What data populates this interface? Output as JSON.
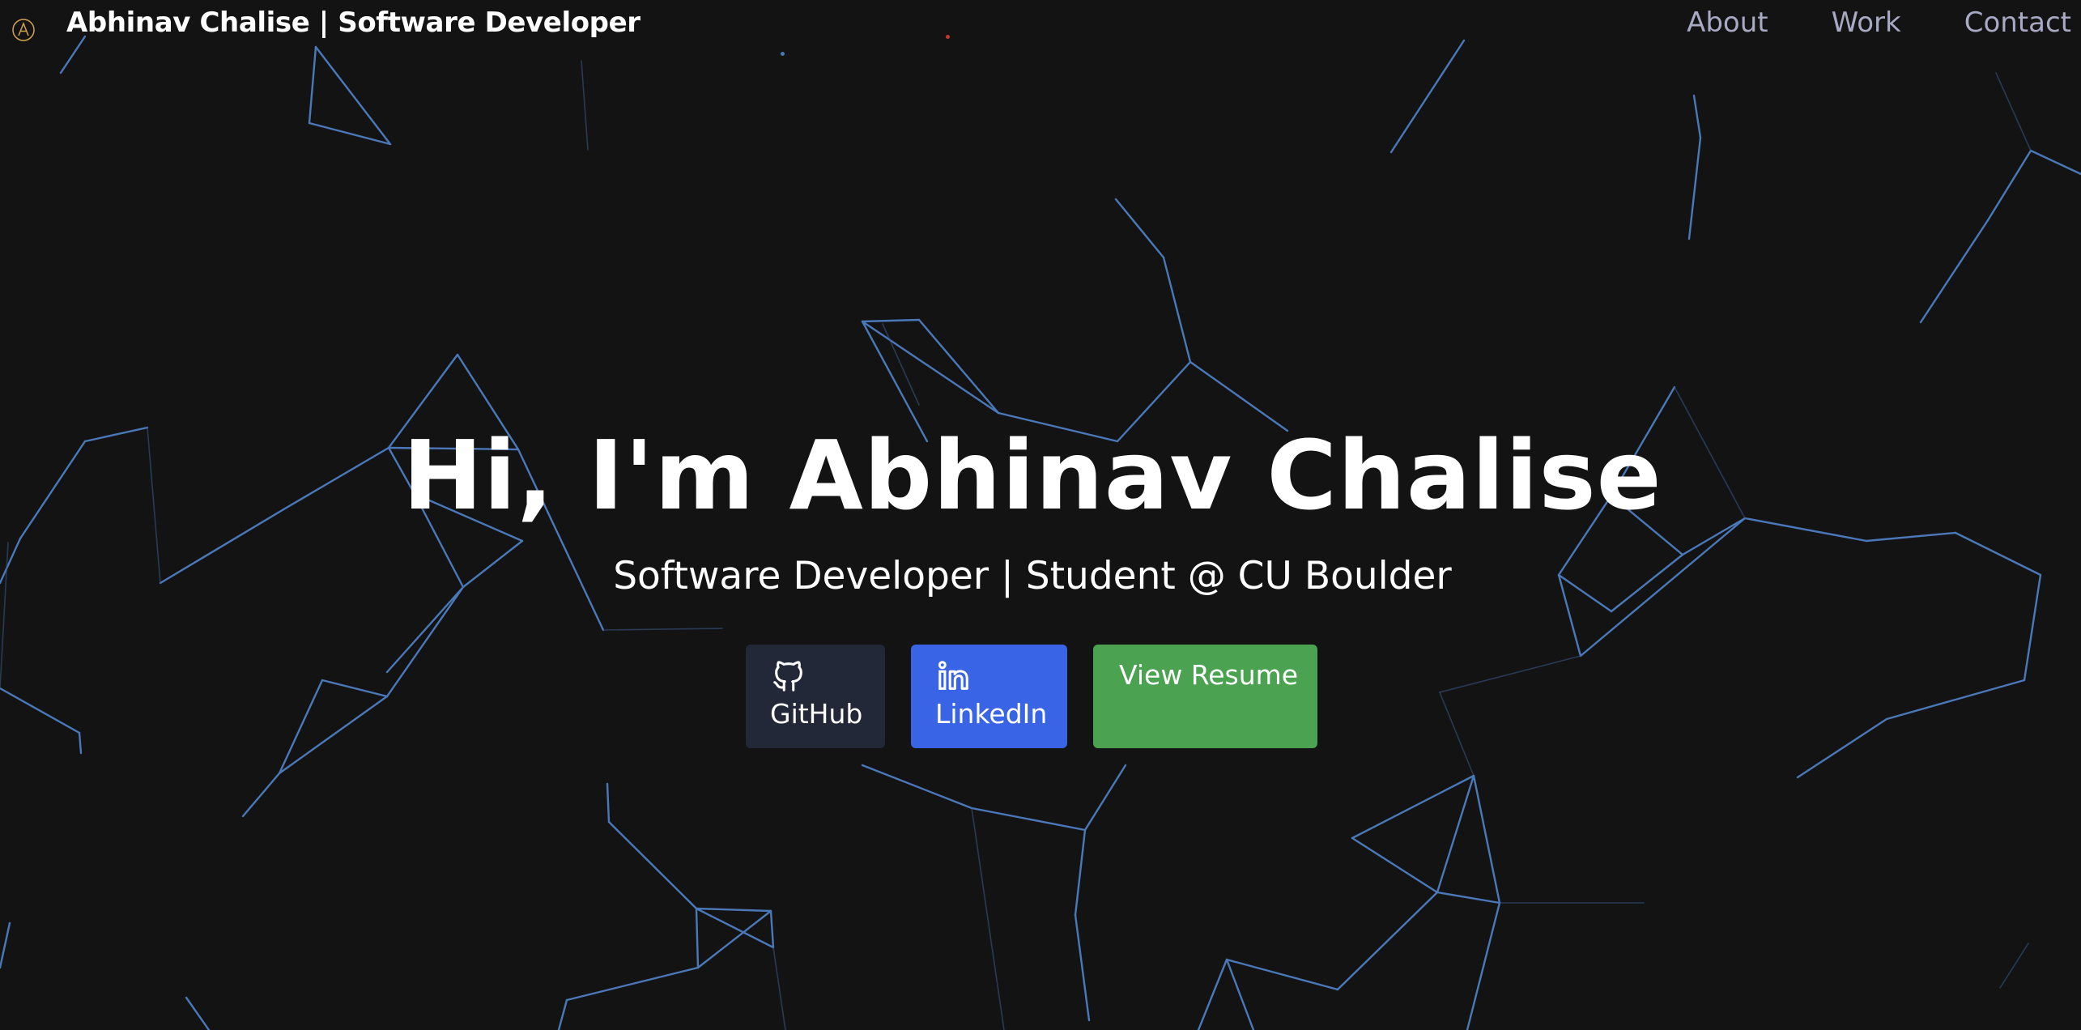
{
  "header": {
    "brand": "Abhinav Chalise  | Software Developer",
    "logo_icon": "circled-a-icon",
    "nav": [
      {
        "label": "About"
      },
      {
        "label": "Work"
      },
      {
        "label": "Contact"
      }
    ]
  },
  "hero": {
    "title": "Hi, I'm Abhinav Chalise",
    "subtitle": "Software Developer | Student @ CU Boulder"
  },
  "buttons": {
    "github": {
      "label": "GitHub",
      "icon": "github-icon",
      "color": "#222838"
    },
    "linkedin": {
      "label": "LinkedIn",
      "icon": "linkedin-icon",
      "color": "#3a64e6"
    },
    "resume": {
      "label": "View Resume",
      "color": "#4ba352"
    }
  },
  "theme": {
    "background": "#131314",
    "network_line": "#4a78b8",
    "nav_text": "#a8a9c3",
    "logo_accent": "#d4a54a"
  }
}
